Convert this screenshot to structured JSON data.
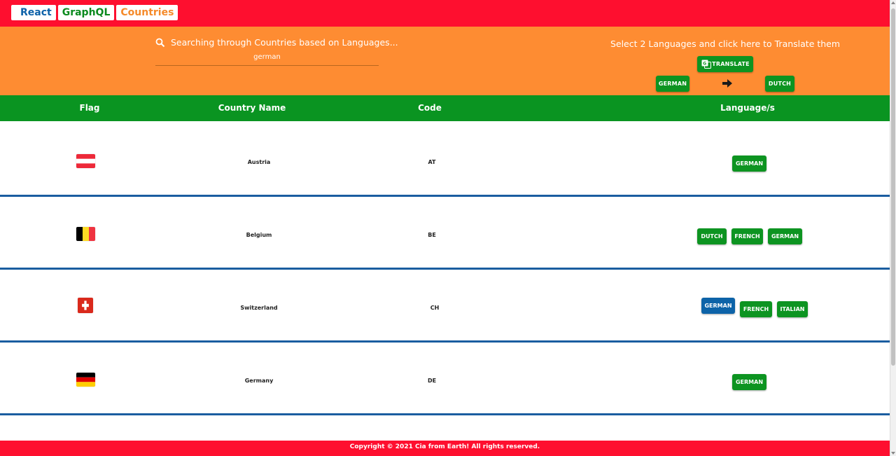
{
  "brand": {
    "part1": "React",
    "part2": "GraphQL",
    "part3": "Countries"
  },
  "search": {
    "label": "Searching through Countries based on Languages...",
    "value": "german"
  },
  "translate": {
    "hint": "Select 2 Languages and click here to Translate them",
    "button_label": "TRANSLATE",
    "from_lang": "GERMAN",
    "to_lang": "DUTCH"
  },
  "table": {
    "headers": [
      "Flag",
      "Country Name",
      "Code",
      "Language/s"
    ],
    "rows": [
      {
        "name": "Austria",
        "code": "AT",
        "languages": [
          "GERMAN"
        ]
      },
      {
        "name": "Belgium",
        "code": "BE",
        "languages": [
          "DUTCH",
          "FRENCH",
          "GERMAN"
        ]
      },
      {
        "name": "Switzerland",
        "code": "CH",
        "languages": [
          "GERMAN",
          "FRENCH",
          "ITALIAN"
        ]
      },
      {
        "name": "Germany",
        "code": "DE",
        "languages": [
          "GERMAN"
        ]
      }
    ]
  },
  "footer": {
    "text": "Copyright © 2021  Cia from Earth! All rights reserved."
  },
  "colors": {
    "red": "#fe0f2f",
    "orange": "#fe8c32",
    "green": "#0a9421",
    "blue": "#0d63a8"
  }
}
